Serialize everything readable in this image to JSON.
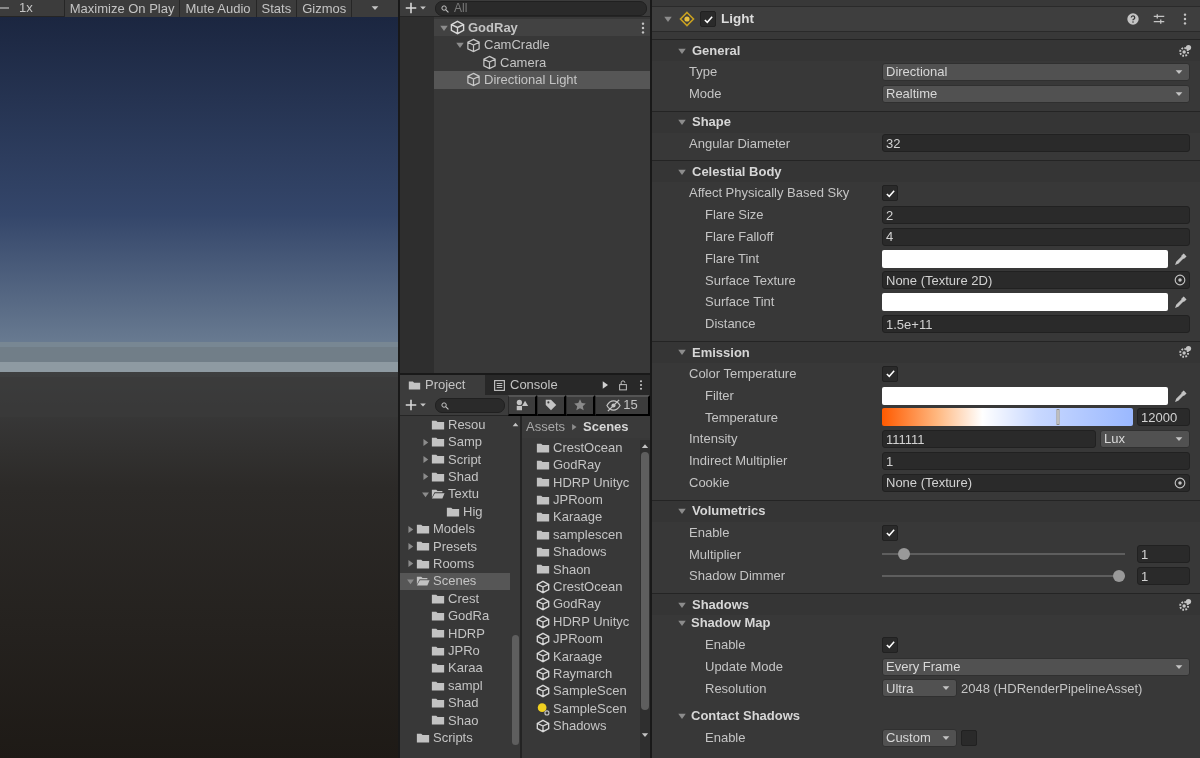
{
  "game_toolbar": {
    "scale": "1x",
    "buttons": [
      "Maximize On Play",
      "Mute Audio",
      "Stats",
      "Gizmos"
    ]
  },
  "hierarchy": {
    "search": {
      "placeholder": "All"
    },
    "items": [
      {
        "label": "GodRay",
        "kind": "scene",
        "expanded": true,
        "selected": false,
        "children": [
          {
            "label": "CamCradle",
            "kind": "object",
            "expanded": true,
            "selected": false,
            "children": [
              {
                "label": "Camera",
                "kind": "object",
                "selected": false
              }
            ]
          },
          {
            "label": "Directional Light",
            "kind": "object",
            "selected": true
          }
        ]
      }
    ]
  },
  "project": {
    "tabs": [
      {
        "label": "Project",
        "kind": "project",
        "selected": true
      },
      {
        "label": "Console",
        "kind": "console",
        "selected": false
      }
    ],
    "hidden_count": "15",
    "tree": [
      {
        "children": [
          {
            "label": "Resou",
            "selected": false
          },
          {
            "label": "Samp",
            "expanded": false,
            "selected": false
          },
          {
            "label": "Script",
            "expanded": false,
            "selected": false
          },
          {
            "label": "Shad",
            "expanded": false,
            "selected": false
          },
          {
            "label": "Textu",
            "expanded": true,
            "selected": false,
            "children": [
              {
                "label": "Hig",
                "selected": false
              }
            ]
          }
        ]
      },
      {
        "label": "Models",
        "expanded": false,
        "selected": false
      },
      {
        "label": "Presets",
        "expanded": false,
        "selected": false
      },
      {
        "label": "Rooms",
        "expanded": false,
        "selected": false
      },
      {
        "label": "Scenes",
        "expanded": true,
        "selected": true,
        "children": [
          {
            "label": "Crest",
            "selected": false
          },
          {
            "label": "GodRa",
            "selected": false
          },
          {
            "label": "HDRP",
            "selected": false
          },
          {
            "label": "JPRo",
            "selected": false
          },
          {
            "label": "Karaa",
            "selected": false
          },
          {
            "label": "sampl",
            "selected": false
          },
          {
            "label": "Shad",
            "selected": false
          },
          {
            "label": "Shao",
            "selected": false
          }
        ]
      },
      {
        "label": "Scripts",
        "selected": false
      }
    ],
    "breadcrumb": [
      "Assets",
      "Scenes"
    ],
    "items": [
      {
        "label": "CrestOcean",
        "kind": "folder"
      },
      {
        "label": "GodRay",
        "kind": "folder"
      },
      {
        "label": "HDRP Unityc",
        "kind": "folder"
      },
      {
        "label": "JPRoom",
        "kind": "folder"
      },
      {
        "label": "Karaage",
        "kind": "folder"
      },
      {
        "label": "samplescen",
        "kind": "folder"
      },
      {
        "label": "Shadows",
        "kind": "folder"
      },
      {
        "label": "Shaon",
        "kind": "folder"
      },
      {
        "label": "CrestOcean",
        "kind": "scene"
      },
      {
        "label": "GodRay",
        "kind": "scene"
      },
      {
        "label": "HDRP Unityc",
        "kind": "scene"
      },
      {
        "label": "JPRoom",
        "kind": "scene"
      },
      {
        "label": "Karaage",
        "kind": "scene"
      },
      {
        "label": "Raymarch",
        "kind": "scene"
      },
      {
        "label": "SampleScen",
        "kind": "scene"
      },
      {
        "label": "SampleScen",
        "kind": "lighting"
      },
      {
        "label": "Shadows",
        "kind": "scene"
      }
    ]
  },
  "inspector": {
    "component": {
      "title": "Light",
      "enabled": true
    },
    "sections": [
      {
        "title": "General",
        "expanded": true,
        "has_menu": true,
        "rows": [
          {
            "label": "Type",
            "kind": "dropdown",
            "value": "Directional"
          },
          {
            "label": "Mode",
            "kind": "dropdown",
            "value": "Realtime"
          }
        ]
      },
      {
        "title": "Shape",
        "expanded": true,
        "has_menu": false,
        "rows": [
          {
            "label": "Angular Diameter",
            "kind": "number",
            "value": "32"
          }
        ]
      },
      {
        "title": "Celestial Body",
        "expanded": true,
        "has_menu": false,
        "rows": [
          {
            "label": "Affect Physically Based Sky",
            "kind": "checkbox",
            "checked": true,
            "children": [
              {
                "label": "Flare Size",
                "kind": "number",
                "value": "2"
              },
              {
                "label": "Flare Falloff",
                "kind": "number",
                "value": "4"
              },
              {
                "label": "Flare Tint",
                "kind": "color",
                "color": "#ffffff"
              },
              {
                "label": "Surface Texture",
                "kind": "object",
                "value": "None (Texture 2D)"
              },
              {
                "label": "Surface Tint",
                "kind": "color",
                "color": "#ffffff"
              },
              {
                "label": "Distance",
                "kind": "number",
                "value": "1.5e+11"
              }
            ]
          }
        ]
      },
      {
        "title": "Emission",
        "expanded": true,
        "has_menu": true,
        "rows": [
          {
            "label": "Color Temperature",
            "kind": "checkbox",
            "checked": true,
            "children": [
              {
                "label": "Filter",
                "kind": "color",
                "color": "#ffffff"
              },
              {
                "label": "Temperature",
                "kind": "temperature",
                "level": 0.7,
                "value": "12000"
              }
            ]
          },
          {
            "label": "Intensity",
            "kind": "number_unit",
            "value": "111111",
            "unit": "Lux"
          },
          {
            "label": "Indirect Multiplier",
            "kind": "number",
            "value": "1"
          },
          {
            "label": "Cookie",
            "kind": "object",
            "value": "None (Texture)"
          }
        ]
      },
      {
        "title": "Volumetrics",
        "expanded": true,
        "has_menu": false,
        "rows": [
          {
            "label": "Enable",
            "kind": "checkbox",
            "checked": true
          },
          {
            "label": "Multiplier",
            "kind": "slider",
            "level": 0.07,
            "value": "1"
          },
          {
            "label": "Shadow Dimmer",
            "kind": "slider",
            "level": 1,
            "value": "1"
          }
        ]
      },
      {
        "title": "Shadows",
        "expanded": true,
        "has_menu": true,
        "rows": [
          {
            "label": "Shadow Map",
            "kind": "group",
            "expanded": true,
            "children": [
              {
                "label": "Enable",
                "kind": "checkbox",
                "checked": true
              },
              {
                "label": "Update Mode",
                "kind": "dropdown",
                "value": "Every Frame"
              },
              {
                "label": "Resolution",
                "kind": "dropdown_note",
                "value": "Ultra",
                "note": "2048 (HDRenderPipelineAsset)"
              }
            ]
          },
          {
            "label": "Contact Shadows",
            "kind": "group",
            "expanded": true,
            "children": [
              {
                "label": "Enable",
                "kind": "dropdown_check",
                "value": "Custom",
                "checked": false
              }
            ]
          }
        ]
      }
    ]
  }
}
